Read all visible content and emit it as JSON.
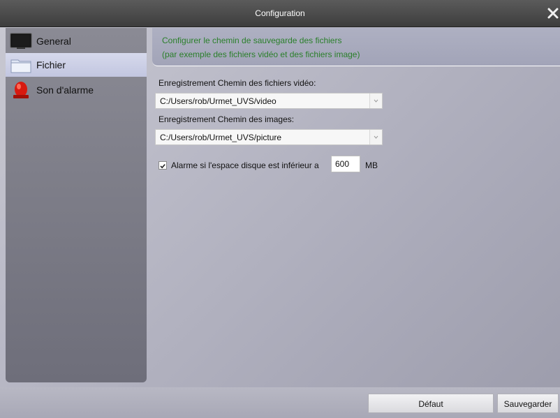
{
  "window": {
    "title": "Configuration"
  },
  "sidebar": {
    "items": [
      {
        "label": "General",
        "icon": "monitor-icon",
        "selected": false
      },
      {
        "label": "Fichier",
        "icon": "folder-icon",
        "selected": true
      },
      {
        "label": "Son d'alarme",
        "icon": "alarm-icon",
        "selected": false
      }
    ]
  },
  "main": {
    "hint_line1": "Configurer le chemin de sauvegarde des fichiers",
    "hint_line2": "(par exemple des fichiers vidéo et des fichiers image)",
    "video_path_label": "Enregistrement Chemin des fichiers vidéo:",
    "video_path_value": "C:/Users/rob/Urmet_UVS/video",
    "image_path_label": "Enregistrement Chemin des images:",
    "image_path_value": "C:/Users/rob/Urmet_UVS/picture",
    "alarm_checkbox_label": "Alarme si l'espace disque est inférieur a",
    "alarm_checkbox_checked": true,
    "disk_threshold_value": "600",
    "disk_threshold_unit": "MB"
  },
  "footer": {
    "default_button": "Défaut",
    "save_button": "Sauvegarder"
  },
  "colors": {
    "hint_text": "#2a7f2a",
    "selected_item": "#c8cce4",
    "titlebar": "#4a4a4a"
  }
}
